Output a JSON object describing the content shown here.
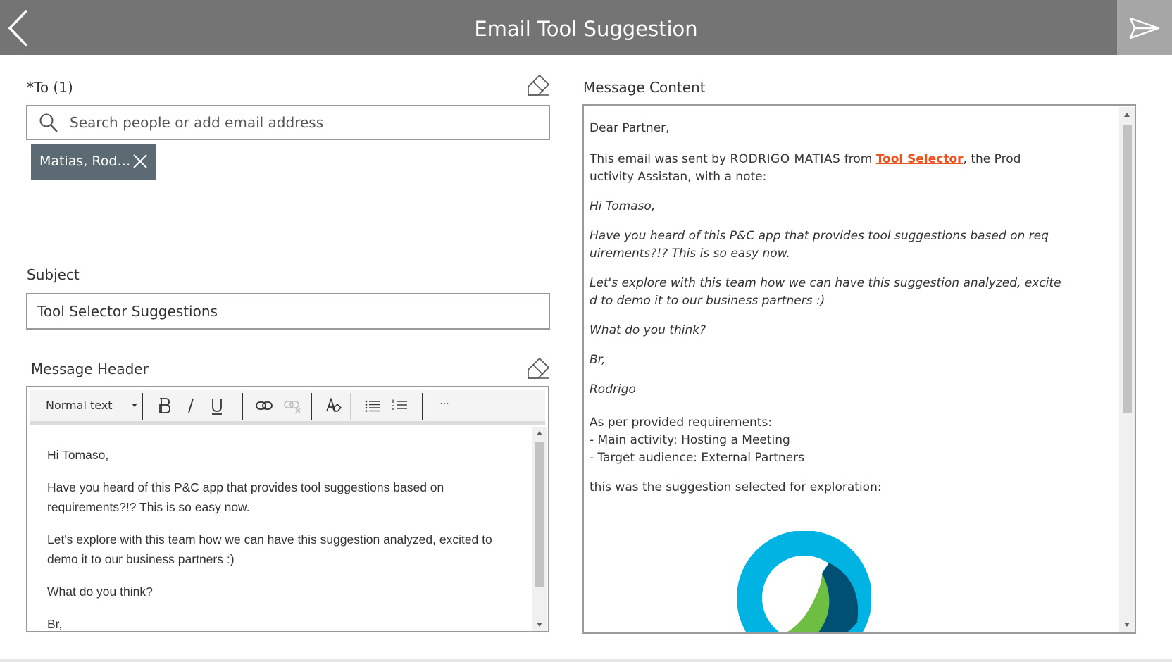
{
  "header": {
    "title": "Email Tool Suggestion",
    "back_icon": "chevron-left-icon",
    "send_icon": "send-icon",
    "bar_color": "#747474"
  },
  "recipients": {
    "label": "*To (1)",
    "clear_icon": "eraser-icon",
    "search_placeholder": "Search people or add email address",
    "chips": [
      {
        "name": "Matias, Rodri..."
      }
    ]
  },
  "subject": {
    "label": "Subject",
    "value": "Tool Selector Suggestions"
  },
  "message_header": {
    "label": "Message Header",
    "clear_icon": "eraser-icon",
    "toolbar": {
      "format_select": "Normal text",
      "more_label": "···"
    },
    "paragraphs": [
      "Hi Tomaso,",
      "Have you heard of this P&C app that provides tool suggestions based on requirements?!? This is so easy now.",
      "Let's explore with this team how we can have this suggestion analyzed, excited to demo it to our business partners :)",
      "What do you think?",
      "Br,"
    ]
  },
  "message_content": {
    "label": "Message Content",
    "greeting": "Dear Partner,",
    "intro_before": "This email was sent by ",
    "sender_name": "RODRIGO MATIAS",
    "intro_from": " from ",
    "link_text": "Tool Selector",
    "intro_after_1": ", the Prod",
    "intro_after_2": "uctivity Assistan, with a note:",
    "note": {
      "greeting": "Hi Tomaso,",
      "p1_line1": "Have you heard of this P&C app that provides tool suggestions based on req",
      "p1_line2": "uirements?!? This is so easy now.",
      "p2_line1": "Let's explore with this team how we can have this suggestion analyzed, excite",
      "p2_line2": "d to demo it to our business partners :)",
      "question": "What do you think?",
      "signoff": "Br,",
      "signature": "Rodrigo"
    },
    "requirements_intro": "As per provided requirements:",
    "requirements": [
      "- Main activity: Hosting a Meeting",
      "- Target audience: External Partners"
    ],
    "selection_text": "this was the suggestion selected for exploration:",
    "logo_icon": "webex-logo-icon",
    "link_color": "#e8531f"
  }
}
